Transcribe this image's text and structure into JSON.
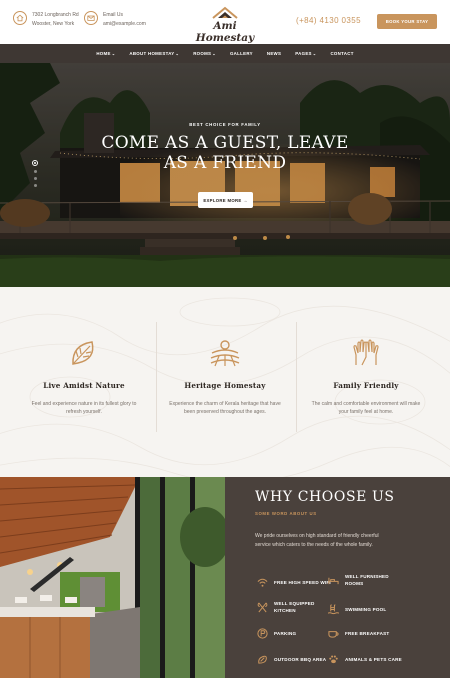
{
  "header": {
    "address_line1": "7302 Longbranch Rd",
    "address_line2": "Wooster, New York",
    "email_label": "Email Us",
    "email_value": "ami@example.com",
    "logo_text": "Ami Homestay",
    "phone": "(+84) 4130 0355",
    "book_button": "BOOK YOUR STAY"
  },
  "nav": {
    "items": [
      {
        "label": "HOME",
        "has_dropdown": true
      },
      {
        "label": "ABOUT HOMESTAY",
        "has_dropdown": true
      },
      {
        "label": "ROOMS",
        "has_dropdown": true
      },
      {
        "label": "GALLERY",
        "has_dropdown": false
      },
      {
        "label": "NEWS",
        "has_dropdown": false
      },
      {
        "label": "PAGES",
        "has_dropdown": true
      },
      {
        "label": "CONTACT",
        "has_dropdown": false
      }
    ],
    "dropdown_glyph": "⌄"
  },
  "hero": {
    "eyebrow": "BEST CHOICE FOR FAMILY",
    "headline_line1": "COME AS A GUEST, LEAVE",
    "headline_line2": "AS A FRIEND",
    "cta": "EXPLORE MORE →",
    "slides_total": 4,
    "slide_active": 1
  },
  "features": [
    {
      "icon": "leaf-icon",
      "title": "Live Amidst Nature",
      "desc": "Feel and experience nature in its fullest glory to refresh yourself."
    },
    {
      "icon": "farm-field-icon",
      "title": "Heritage Homestay",
      "desc": "Experience the charm of Kerala heritage that have been preserved throughout the ages."
    },
    {
      "icon": "hands-icon",
      "title": "Family Friendly",
      "desc": "The calm and comfortable environment will make your family feel at home."
    }
  ],
  "why": {
    "title": "WHY CHOOSE US",
    "subtitle": "SOME WORD ABOUT US",
    "body": "We pride ourselves on high standard of friendly cheerful service which caters to the needs of the whole family.",
    "amenities": [
      {
        "icon": "wifi-icon",
        "label": "FREE HIGH SPEED WIFI"
      },
      {
        "icon": "bed-icon",
        "label_line1": "WELL FURNISHED",
        "label_line2": "ROOMS"
      },
      {
        "icon": "utensils-icon",
        "label_line1": "WELL EQUIPPED",
        "label_line2": "KITCHEN"
      },
      {
        "icon": "pool-icon",
        "label": "SWIMMING POOL"
      },
      {
        "icon": "parking-icon",
        "label": "PARKING"
      },
      {
        "icon": "coffee-icon",
        "label": "FREE BREAKFAST"
      },
      {
        "icon": "bbq-icon",
        "label": "OUTDOOR BBQ AREA"
      },
      {
        "icon": "paw-icon",
        "label": "ANIMALS & PETS CARE"
      }
    ]
  },
  "colors": {
    "accent": "#c9955d",
    "nav_bg": "#3e3733",
    "why_bg": "#4a413c",
    "features_bg": "#f6f4f1"
  }
}
